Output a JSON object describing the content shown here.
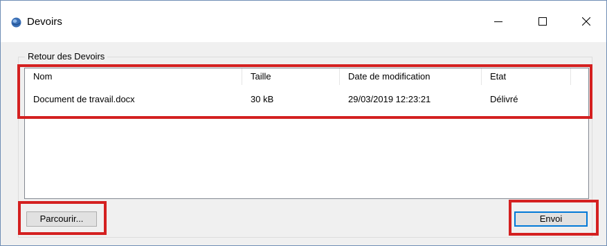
{
  "window": {
    "title": "Devoirs",
    "icon": "app-globe-icon",
    "controls": [
      "minimize-icon",
      "maximize-icon",
      "close-icon"
    ]
  },
  "group": {
    "label": "Retour des Devoirs"
  },
  "list": {
    "columns": [
      "Nom",
      "Taille",
      "Date de modification",
      "Etat"
    ],
    "rows": [
      [
        "Document de travail.docx",
        "30 kB",
        "29/03/2019 12:23:21",
        "Délivré"
      ]
    ]
  },
  "buttons": {
    "browse_label": "Parcourir...",
    "send_label": "Envoi"
  },
  "colors": {
    "highlight": "#d42020",
    "accent": "#0078d7"
  }
}
